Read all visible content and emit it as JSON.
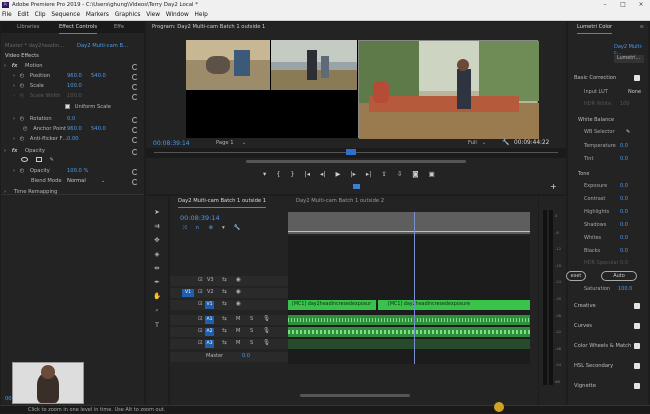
{
  "titlebar": {
    "app_icon": "Pr",
    "title": "Adobe Premiere Pro 2019 - C:\\Users\\ghung\\Videos\\Terry Day2 Local *"
  },
  "menubar": [
    "File",
    "Edit",
    "Clip",
    "Sequence",
    "Markers",
    "Graphics",
    "View",
    "Window",
    "Help"
  ],
  "left_panel": {
    "tabs": [
      "Libraries",
      "Effect Controls",
      "Effe"
    ],
    "source_label": "Master * day2headin…",
    "clip_label": "Day2 Multi-cam B…",
    "video_effects": "Video Effects",
    "motion": "Motion",
    "position": {
      "label": "Position",
      "x": "960.0",
      "y": "540.0"
    },
    "scale": {
      "label": "Scale",
      "value": "100.0"
    },
    "scale_width": {
      "label": "Scale Width",
      "value": "100.0"
    },
    "uniform_scale": "Uniform Scale",
    "rotation": {
      "label": "Rotation",
      "value": "0.0"
    },
    "anchor_point": {
      "label": "Anchor Point",
      "x": "960.0",
      "y": "540.0"
    },
    "anti_flicker": {
      "label": "Anti-flicker F…",
      "value": "0.00"
    },
    "opacity_group": "Opacity",
    "opacity": {
      "label": "Opacity",
      "value": "100.0 %"
    },
    "blend_mode": {
      "label": "Blend Mode",
      "value": "Normal"
    },
    "time_remapping": "Time Remapping",
    "timecode": "00:08"
  },
  "program_monitor": {
    "title": "Program: Day2 Multi-cam Batch 1 outside 1",
    "timecode": "00:08:39:14",
    "page": "Page 1",
    "quality": "Full",
    "duration": "00:09:44:22"
  },
  "timeline": {
    "tabs": [
      "Day2 Multi-cam Batch 1 outside 1",
      "Day2 Multi-cam Batch 1 outside 2"
    ],
    "timecode": "00:08:39:14",
    "video_tracks": [
      "V3",
      "V2",
      "V1"
    ],
    "audio_tracks": [
      "A1",
      "A2",
      "A3"
    ],
    "src_video": "V1",
    "src_audio": "A1",
    "master": {
      "label": "Master",
      "value": "0.0"
    },
    "clip1": "[MC1] day2headincresedexposur",
    "clip2": "[MC1] day2headincresedexposure",
    "mute": "M",
    "solo": "S",
    "meter_labels": [
      "0",
      "-6",
      "-12",
      "-18",
      "-24",
      "-30",
      "-36",
      "-42",
      "-48",
      "-54",
      "dB"
    ]
  },
  "lumetri": {
    "title": "Lumetri Color",
    "clip": "Day2 Multi-c…",
    "clip_short": "Lumetri…",
    "sections": [
      "Basic Correction",
      "Creative",
      "Curves",
      "Color Wheels & Match",
      "HSL Secondary",
      "Vignette"
    ],
    "input_lut": {
      "label": "Input LUT",
      "value": "None"
    },
    "hdr_white": {
      "label": "HDR White",
      "value": "100"
    },
    "white_balance": "White Balance",
    "wb_selector": "WB Selector",
    "temperature": {
      "label": "Temperature",
      "value": "0.0"
    },
    "tint": {
      "label": "Tint",
      "value": "0.0"
    },
    "tone": "Tone",
    "tone_rows": [
      {
        "label": "Exposure",
        "value": "0.0"
      },
      {
        "label": "Contrast",
        "value": "0.0"
      },
      {
        "label": "Highlights",
        "value": "0.0"
      },
      {
        "label": "Shadows",
        "value": "0.0"
      },
      {
        "label": "Whites",
        "value": "0.0"
      },
      {
        "label": "Blacks",
        "value": "0.0"
      },
      {
        "label": "HDR Specular",
        "value": "0.0"
      }
    ],
    "reset_button": "eset",
    "auto_button": "Auto",
    "saturation": {
      "label": "Saturation",
      "value": "100.0"
    }
  },
  "status": "Click to zoom in one level in time. Use Alt to zoom out.",
  "colors": {
    "accent": "#4b9bef",
    "clip_green": "#39c34a",
    "playhead": "#f0c040"
  },
  "icons": [
    "premiere-icon",
    "reset-icon",
    "toggle-arrow-icon",
    "fx-icon",
    "keyframe-icon",
    "ellipse-mask-icon",
    "rect-mask-icon",
    "pen-icon",
    "wrench-icon",
    "settings-icon",
    "play-icon",
    "step-back-icon",
    "step-forward-icon",
    "marker-icon",
    "lock-icon",
    "eye-icon",
    "mic-icon",
    "selection-tool-icon",
    "track-select-icon",
    "ripple-tool-icon",
    "razor-icon",
    "slip-tool-icon",
    "pen-tool-icon",
    "hand-tool-icon",
    "type-tool-icon",
    "eyedropper-icon",
    "plus-icon"
  ]
}
